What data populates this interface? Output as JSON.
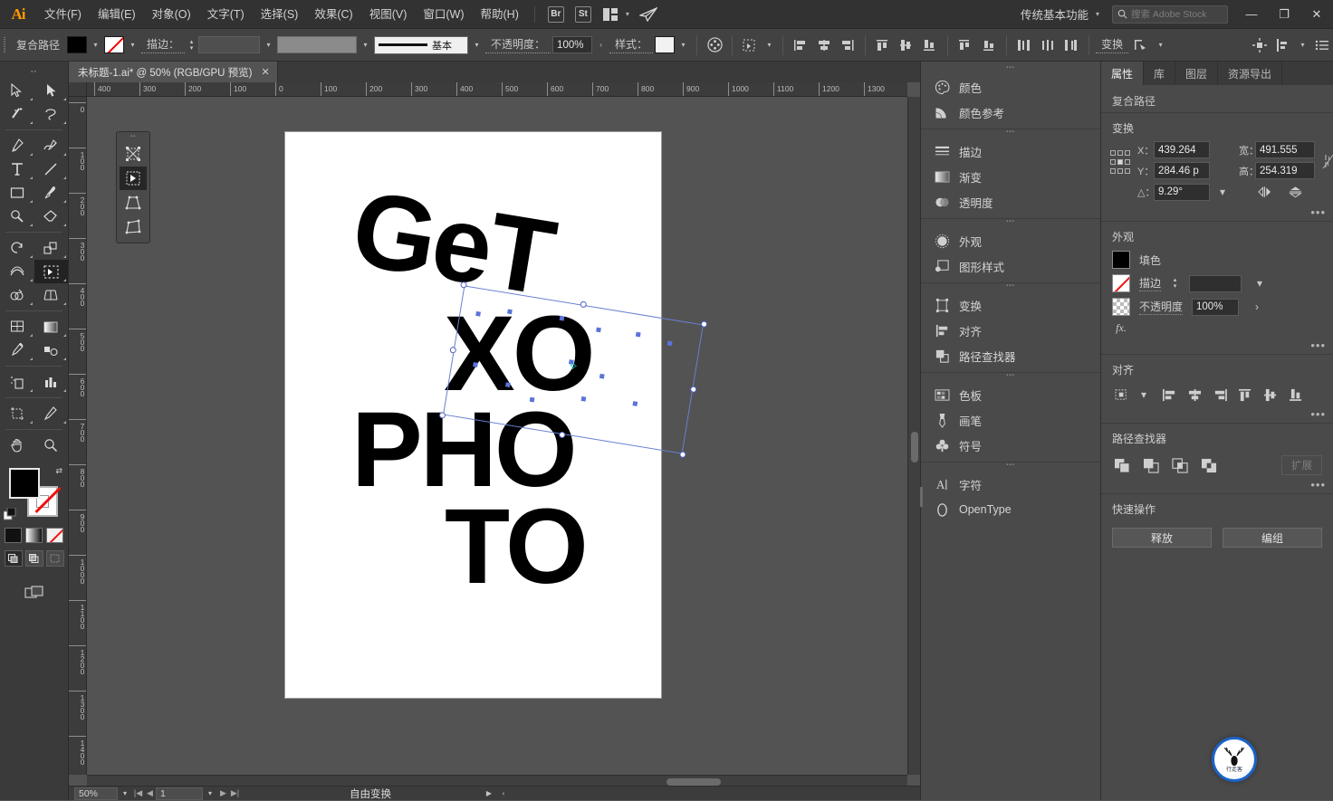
{
  "app": {
    "name": "Adobe Illustrator",
    "logo_text": "Ai"
  },
  "menubar": {
    "items": [
      {
        "label": "文件(F)",
        "name": "menu-file"
      },
      {
        "label": "编辑(E)",
        "name": "menu-edit"
      },
      {
        "label": "对象(O)",
        "name": "menu-object"
      },
      {
        "label": "文字(T)",
        "name": "menu-type"
      },
      {
        "label": "选择(S)",
        "name": "menu-select"
      },
      {
        "label": "效果(C)",
        "name": "menu-effect"
      },
      {
        "label": "视图(V)",
        "name": "menu-view"
      },
      {
        "label": "窗口(W)",
        "name": "menu-window"
      },
      {
        "label": "帮助(H)",
        "name": "menu-help"
      }
    ],
    "bridge_badge": "Br",
    "stock_badge": "St",
    "workspace": "传统基本功能",
    "search_placeholder": "搜索 Adobe Stock",
    "window_controls": {
      "minimize": "—",
      "maximize": "❐",
      "close": "✕"
    }
  },
  "controlbar": {
    "object_type": "复合路径",
    "fill_swatch": "#000000",
    "stroke_swatch": "none",
    "stroke_label": "描边：",
    "stroke_weight": "",
    "stroke_profile": "基本",
    "opacity_label": "不透明度：",
    "opacity_value": "100%",
    "style_label": "样式：",
    "transform_label": "变换"
  },
  "document": {
    "tab_title": "未标题-1.ai* @ 50% (RGB/GPU 预览)",
    "close_glyph": "✕"
  },
  "rulers": {
    "horizontal": [
      "400",
      "300",
      "200",
      "100",
      "0",
      "100",
      "200",
      "300",
      "400",
      "500",
      "600",
      "700",
      "800",
      "900",
      "1000",
      "1100",
      "1200",
      "1300"
    ],
    "vertical": [
      "0",
      "100",
      "200",
      "300",
      "400",
      "500",
      "600",
      "700",
      "800",
      "900",
      "1000",
      "1100",
      "1200",
      "1300",
      "1400"
    ]
  },
  "artwork": {
    "lines": [
      "GeT",
      "XO",
      "PHO",
      "TO"
    ],
    "fill_color": "#000000",
    "selection_color": "#5a74d8",
    "center_point_color": "#16d0c8"
  },
  "statusbar": {
    "zoom": "50%",
    "page": "1",
    "tool_status": "自由变换"
  },
  "toolbar": {
    "tools": [
      {
        "name": "selection-tool"
      },
      {
        "name": "direct-selection-tool"
      },
      {
        "name": "magic-wand-tool"
      },
      {
        "name": "lasso-tool"
      },
      {
        "name": "pen-tool"
      },
      {
        "name": "curvature-tool"
      },
      {
        "name": "type-tool"
      },
      {
        "name": "line-segment-tool"
      },
      {
        "name": "rectangle-tool"
      },
      {
        "name": "paintbrush-tool"
      },
      {
        "name": "shaper-tool"
      },
      {
        "name": "eraser-tool"
      },
      {
        "name": "rotate-tool"
      },
      {
        "name": "scale-tool"
      },
      {
        "name": "width-tool"
      },
      {
        "name": "free-transform-tool"
      },
      {
        "name": "shape-builder-tool"
      },
      {
        "name": "perspective-grid-tool"
      },
      {
        "name": "mesh-tool"
      },
      {
        "name": "gradient-tool"
      },
      {
        "name": "eyedropper-tool"
      },
      {
        "name": "blend-tool"
      },
      {
        "name": "symbol-sprayer-tool"
      },
      {
        "name": "column-graph-tool"
      },
      {
        "name": "artboard-tool"
      },
      {
        "name": "slice-tool"
      },
      {
        "name": "hand-tool"
      },
      {
        "name": "zoom-tool"
      }
    ],
    "fill_color": "#000000",
    "stroke_color": "none"
  },
  "float_palette": {
    "tools": [
      {
        "name": "free-distort-tool",
        "selected": false
      },
      {
        "name": "free-transform-tool",
        "selected": true
      },
      {
        "name": "perspective-distort-tool",
        "selected": false
      },
      {
        "name": "free-distort-corner-tool",
        "selected": false
      }
    ]
  },
  "icon_dock": {
    "groups": [
      {
        "items": [
          {
            "label": "颜色",
            "icon": "color-palette-icon",
            "name": "dock-item-color"
          },
          {
            "label": "颜色参考",
            "icon": "color-guide-icon",
            "name": "dock-item-color-guide"
          }
        ]
      },
      {
        "items": [
          {
            "label": "描边",
            "icon": "stroke-icon",
            "name": "dock-item-stroke"
          },
          {
            "label": "渐变",
            "icon": "gradient-icon",
            "name": "dock-item-gradient"
          },
          {
            "label": "透明度",
            "icon": "transparency-icon",
            "name": "dock-item-transparency"
          }
        ]
      },
      {
        "items": [
          {
            "label": "外观",
            "icon": "appearance-icon",
            "name": "dock-item-appearance"
          },
          {
            "label": "图形样式",
            "icon": "graphic-styles-icon",
            "name": "dock-item-graphic-styles"
          }
        ]
      },
      {
        "items": [
          {
            "label": "变换",
            "icon": "transform-icon",
            "name": "dock-item-transform"
          },
          {
            "label": "对齐",
            "icon": "align-icon",
            "name": "dock-item-align"
          },
          {
            "label": "路径查找器",
            "icon": "pathfinder-icon",
            "name": "dock-item-pathfinder"
          }
        ]
      },
      {
        "items": [
          {
            "label": "色板",
            "icon": "swatches-icon",
            "name": "dock-item-swatches"
          },
          {
            "label": "画笔",
            "icon": "brushes-icon",
            "name": "dock-item-brushes"
          },
          {
            "label": "符号",
            "icon": "symbols-icon",
            "name": "dock-item-symbols"
          }
        ]
      },
      {
        "items": [
          {
            "label": "字符",
            "icon": "character-icon",
            "name": "dock-item-character"
          },
          {
            "label": "OpenType",
            "icon": "opentype-icon",
            "name": "dock-item-opentype"
          }
        ]
      }
    ]
  },
  "properties": {
    "tabs": [
      {
        "label": "属性",
        "active": true
      },
      {
        "label": "库",
        "active": false
      },
      {
        "label": "图层",
        "active": false
      },
      {
        "label": "资源导出",
        "active": false
      }
    ],
    "object_type": "复合路径",
    "transform": {
      "title": "变换",
      "x_label": "X：",
      "x_value": "439.264",
      "y_label": "Y：",
      "y_value": "284.46 p",
      "w_label": "宽：",
      "w_value": "491.555",
      "h_label": "高：",
      "h_value": "254.319",
      "angle_label": "△：",
      "angle_value": "9.29°",
      "more": "•••"
    },
    "appearance": {
      "title": "外观",
      "fill_label": "填色",
      "stroke_label": "描边",
      "stroke_value": "",
      "opacity_label": "不透明度",
      "opacity_value": "100%",
      "fx_label": "fx.",
      "more": "•••"
    },
    "align": {
      "title": "对齐",
      "more": "•••"
    },
    "pathfinder": {
      "title": "路径查找器",
      "more": "•••",
      "expand_label": "扩展"
    },
    "quick_actions": {
      "title": "快速操作",
      "buttons": [
        {
          "label": "释放",
          "name": "release-button"
        },
        {
          "label": "编组",
          "name": "group-button"
        }
      ]
    }
  },
  "watermark": {
    "text": "行走客"
  }
}
